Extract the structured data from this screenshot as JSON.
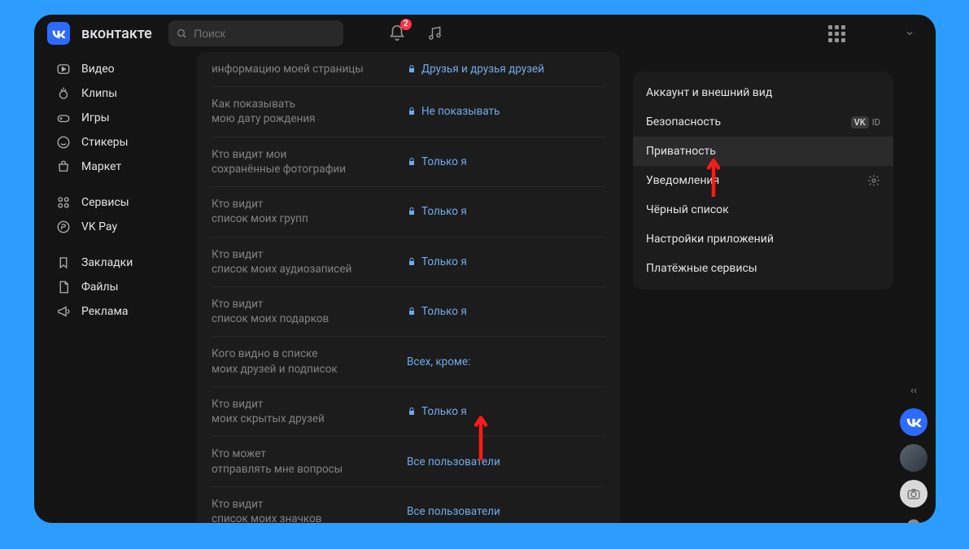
{
  "brand": "вконтакте",
  "search": {
    "placeholder": "Поиск"
  },
  "notifications": {
    "count": "2"
  },
  "sidebar": {
    "items": [
      {
        "label": "Видео"
      },
      {
        "label": "Клипы"
      },
      {
        "label": "Игры"
      },
      {
        "label": "Стикеры"
      },
      {
        "label": "Маркет"
      },
      {
        "label": "Сервисы"
      },
      {
        "label": "VK Pay"
      },
      {
        "label": "Закладки"
      },
      {
        "label": "Файлы"
      },
      {
        "label": "Реклама"
      }
    ]
  },
  "privacy_row_top": {
    "label": "информацию моей страницы",
    "value": "Друзья и друзья друзей"
  },
  "privacy_rows": [
    {
      "label": "Как показывать\nмою дату рождения",
      "value": "Не показывать",
      "lock": true
    },
    {
      "label": "Кто видит мои\nсохранённые фотографии",
      "value": "Только я",
      "lock": true
    },
    {
      "label": "Кто видит\nсписок моих групп",
      "value": "Только я",
      "lock": true
    },
    {
      "label": "Кто видит\nсписок моих аудиозаписей",
      "value": "Только я",
      "lock": true
    },
    {
      "label": "Кто видит\nсписок моих подарков",
      "value": "Только я",
      "lock": true
    },
    {
      "label": "Кого видно в списке\nмоих друзей и подписок",
      "value": "Всех, кроме:",
      "lock": false
    },
    {
      "label": "Кто видит\nмоих скрытых друзей",
      "value": "Только я",
      "lock": true
    },
    {
      "label": "Кто может\nотправлять мне вопросы",
      "value": "Все пользователи",
      "lock": false
    },
    {
      "label": "Кто видит\nсписок моих значков",
      "value": "Все пользователи",
      "lock": false
    }
  ],
  "settings_menu": {
    "items": [
      {
        "label": "Аккаунт и внешний вид",
        "active": false
      },
      {
        "label": "Безопасность",
        "active": false,
        "vkid": true
      },
      {
        "label": "Приватность",
        "active": true
      },
      {
        "label": "Уведомления",
        "active": false,
        "gear": true
      },
      {
        "label": "Чёрный список",
        "active": false
      },
      {
        "label": "Настройки приложений",
        "active": false
      },
      {
        "label": "Платёжные сервисы",
        "active": false
      }
    ],
    "vkid_label": "ID"
  }
}
